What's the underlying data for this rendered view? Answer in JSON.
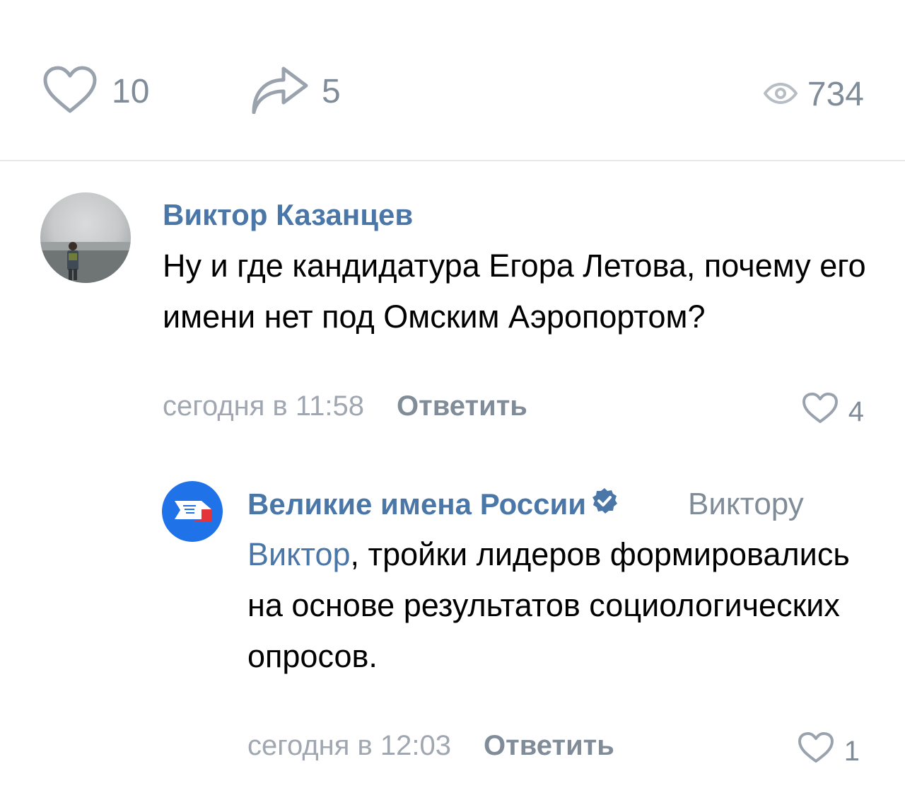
{
  "post_actions": {
    "likes_count": "10",
    "shares_count": "5",
    "views_count": "734"
  },
  "comments": [
    {
      "author": "Виктор Казанцев",
      "text": "Ну и где кандидатура Егора Летова, почему его имени нет под Омским Аэропортом?",
      "time": "сегодня в 11:58",
      "reply_label": "Ответить",
      "likes": "4"
    },
    {
      "author": "Великие имена России",
      "reply_to": "Виктору",
      "mention": "Виктор",
      "text": ", тройки лидеров формировались на основе результатов социологических опросов.",
      "time": "сегодня в 12:03",
      "reply_label": "Ответить",
      "likes": "1"
    }
  ],
  "colors": {
    "link": "#4a76a8",
    "secondary": "#818c99",
    "divider": "#e7e8ec",
    "group_avatar_bg": "#1f72e8"
  },
  "icons": {
    "like": "heart-outline-icon",
    "share": "share-arrow-icon",
    "views": "eye-icon",
    "verified": "verified-badge-icon"
  }
}
